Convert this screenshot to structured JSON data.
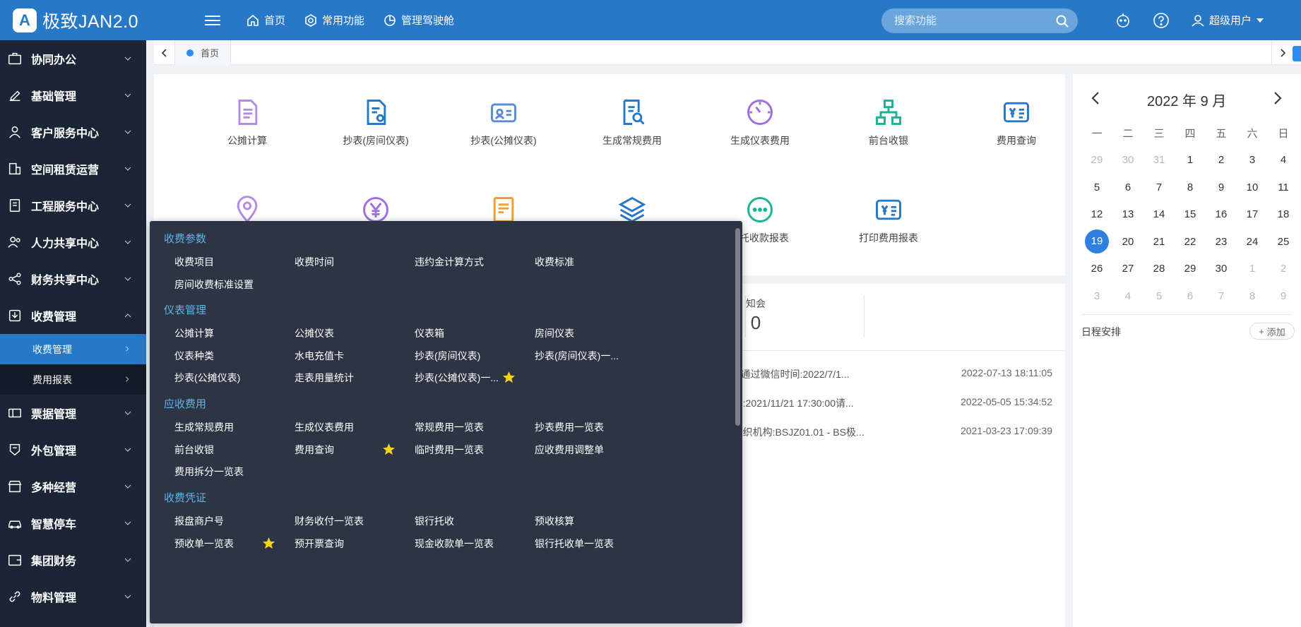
{
  "app": {
    "title": "极致JAN2.0",
    "logo_letter": "A"
  },
  "topnav": {
    "home": "首页",
    "common": "常用功能",
    "cockpit": "管理驾驶舱"
  },
  "search": {
    "placeholder": "搜索功能"
  },
  "user": {
    "name": "超级用户"
  },
  "sidebar": {
    "items": [
      {
        "label": "协同办公",
        "icon": "briefcase-icon"
      },
      {
        "label": "基础管理",
        "icon": "edit-icon"
      },
      {
        "label": "客户服务中心",
        "icon": "person-icon"
      },
      {
        "label": "空间租赁运营",
        "icon": "building-icon"
      },
      {
        "label": "工程服务中心",
        "icon": "tools-icon"
      },
      {
        "label": "人力共享中心",
        "icon": "people-icon"
      },
      {
        "label": "财务共享中心",
        "icon": "share-icon"
      },
      {
        "label": "收费管理",
        "icon": "download-icon"
      },
      {
        "label": "票据管理",
        "icon": "ticket-icon"
      },
      {
        "label": "外包管理",
        "icon": "outsource-icon"
      },
      {
        "label": "多种经营",
        "icon": "store-icon"
      },
      {
        "label": "智慧停车",
        "icon": "car-icon"
      },
      {
        "label": "集团财务",
        "icon": "wallet-icon"
      },
      {
        "label": "物料管理",
        "icon": "link-icon"
      }
    ],
    "sub_items": [
      {
        "label": "收费管理"
      },
      {
        "label": "费用报表"
      }
    ]
  },
  "tabs": {
    "home": "首页"
  },
  "apps": [
    {
      "label": "公摊计算"
    },
    {
      "label": "抄表(房间仪表)"
    },
    {
      "label": "抄表(公摊仪表)"
    },
    {
      "label": "生成常规费用"
    },
    {
      "label": "生成仪表费用"
    },
    {
      "label": "前台收银"
    },
    {
      "label": "费用查询"
    },
    {
      "label": "...托收款报表"
    },
    {
      "label": "打印费用报表"
    }
  ],
  "stats": {
    "label": "知会",
    "value": "0"
  },
  "messages": [
    {
      "text": "- 通过微信时间:2022/7/1...",
      "time": "2022-07-13 18:11:05"
    },
    {
      "text": "...:2021/11/21 17:30:00请...",
      "time": "2022-05-05 15:34:52"
    },
    {
      "text": "...织机构:BSJZ01.01 - BS极...",
      "time": "2021-03-23 17:09:39"
    }
  ],
  "calendar": {
    "title": "2022 年 9 月",
    "weekdays": [
      "一",
      "二",
      "三",
      "四",
      "五",
      "六",
      "日"
    ],
    "weeks": [
      [
        "29",
        "30",
        "31",
        "1",
        "2",
        "3",
        "4"
      ],
      [
        "5",
        "6",
        "7",
        "8",
        "9",
        "10",
        "11"
      ],
      [
        "12",
        "13",
        "14",
        "15",
        "16",
        "17",
        "18"
      ],
      [
        "19",
        "20",
        "21",
        "22",
        "23",
        "24",
        "25"
      ],
      [
        "26",
        "27",
        "28",
        "29",
        "30",
        "1",
        "2"
      ],
      [
        "3",
        "4",
        "5",
        "6",
        "7",
        "8",
        "9"
      ]
    ],
    "today": "19",
    "schedule_label": "日程安排",
    "add_label": "添加"
  },
  "flyout": {
    "groups": [
      {
        "title": "收费参数",
        "items": [
          "收费项目",
          "收费时间",
          "违约金计算方式",
          "收费标准",
          "房间收费标准设置"
        ]
      },
      {
        "title": "仪表管理",
        "items": [
          "公摊计算",
          "公摊仪表",
          "仪表箱",
          "房间仪表",
          "仪表种类",
          "水电充值卡",
          "抄表(房间仪表)",
          "抄表(房间仪表)一...",
          "抄表(公摊仪表)",
          "走表用量统计",
          "抄表(公摊仪表)一..."
        ]
      },
      {
        "title": "应收费用",
        "items": [
          "生成常规费用",
          "生成仪表费用",
          "常规费用一览表",
          "抄表费用一览表",
          "前台收银",
          "费用查询",
          "临时费用一览表",
          "应收费用调整单",
          "费用拆分一览表"
        ]
      },
      {
        "title": "收费凭证",
        "items": [
          "报盘商户号",
          "财务收付一览表",
          "银行托收",
          "预收核算",
          "预收单一览表",
          "预开票查询",
          "现金收款单一览表",
          "银行托收单一览表"
        ]
      }
    ]
  },
  "colors": {
    "brand": "#2878c8",
    "sidebar_bg": "#1b2536",
    "flyout_bg": "#2d3544",
    "group_title": "#5fb5ea",
    "star": "#f8d21b"
  }
}
